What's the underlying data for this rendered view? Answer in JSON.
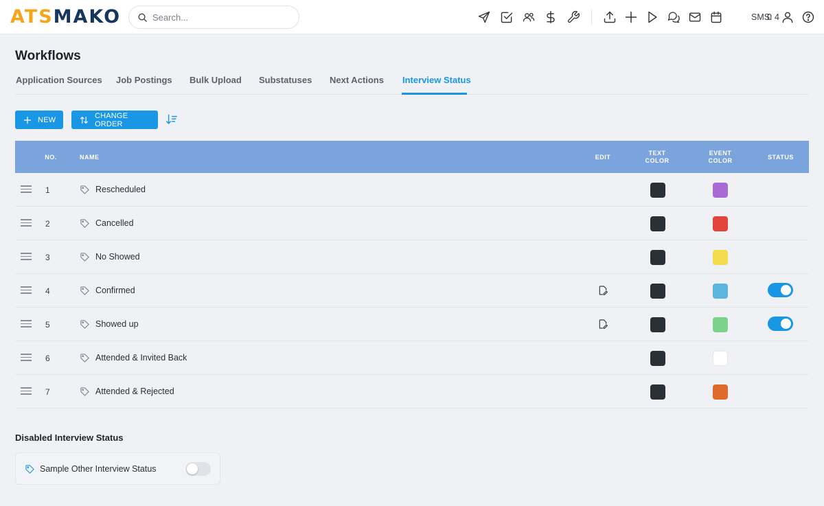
{
  "app": {
    "logo_part1": "ATS",
    "logo_part2": "MAKO"
  },
  "search": {
    "placeholder": "Search..."
  },
  "header_icons": [
    "send-icon",
    "tasks-check-icon",
    "people-icon",
    "dollar-icon",
    "wrench-icon",
    "upload-icon",
    "plus-icon",
    "play-icon",
    "chat-icon",
    "mail-icon",
    "calendar-icon",
    "user-icon",
    "help-icon"
  ],
  "header": {
    "sms_label": "SMS: 4",
    "notification_count": "0"
  },
  "page": {
    "title": "Workflows",
    "tabs": [
      {
        "label": "Application Sources",
        "active": false
      },
      {
        "label": "Job Postings",
        "active": false
      },
      {
        "label": "Bulk Upload",
        "active": false
      },
      {
        "label": "Substatuses",
        "active": false
      },
      {
        "label": "Next Actions",
        "active": false
      },
      {
        "label": "Interview Status",
        "active": true
      }
    ]
  },
  "toolbar": {
    "new_label": "NEW",
    "change_order_label": "CHANGE ORDER"
  },
  "table": {
    "columns": {
      "no": "NO.",
      "name": "NAME",
      "edit": "EDIT",
      "text_color_1": "TEXT",
      "text_color_2": "COLOR",
      "event_color_1": "EVENT",
      "event_color_2": "COLOR",
      "status": "STATUS"
    },
    "rows": [
      {
        "no": "1",
        "name": "Rescheduled",
        "editable": false,
        "text_color": "#2b2f36",
        "event_color": "#a86bd6",
        "status_toggle": false
      },
      {
        "no": "2",
        "name": "Cancelled",
        "editable": false,
        "text_color": "#2b2f36",
        "event_color": "#e3443b",
        "status_toggle": false
      },
      {
        "no": "3",
        "name": "No Showed",
        "editable": false,
        "text_color": "#2b2f36",
        "event_color": "#f1dd4d",
        "status_toggle": false
      },
      {
        "no": "4",
        "name": "Confirmed",
        "editable": true,
        "text_color": "#2b2f36",
        "event_color": "#5ab6df",
        "status_toggle": true,
        "status_on": true
      },
      {
        "no": "5",
        "name": "Showed up",
        "editable": true,
        "text_color": "#2b2f36",
        "event_color": "#7dd28b",
        "status_toggle": true,
        "status_on": true
      },
      {
        "no": "6",
        "name": "Attended & Invited Back",
        "editable": false,
        "text_color": "#2b2f36",
        "event_color": "#ffffff",
        "status_toggle": false
      },
      {
        "no": "7",
        "name": "Attended & Rejected",
        "editable": false,
        "text_color": "#2b2f36",
        "event_color": "#e06a2c",
        "status_toggle": false
      }
    ]
  },
  "disabled": {
    "title": "Disabled Interview Status",
    "items": [
      {
        "name": "Sample Other Interview Status",
        "enabled": false
      }
    ]
  },
  "colors": {
    "accent": "#1a97e4",
    "table_header": "#7ba3dc",
    "logo_orange": "#f3a51c",
    "logo_navy": "#16365f"
  }
}
